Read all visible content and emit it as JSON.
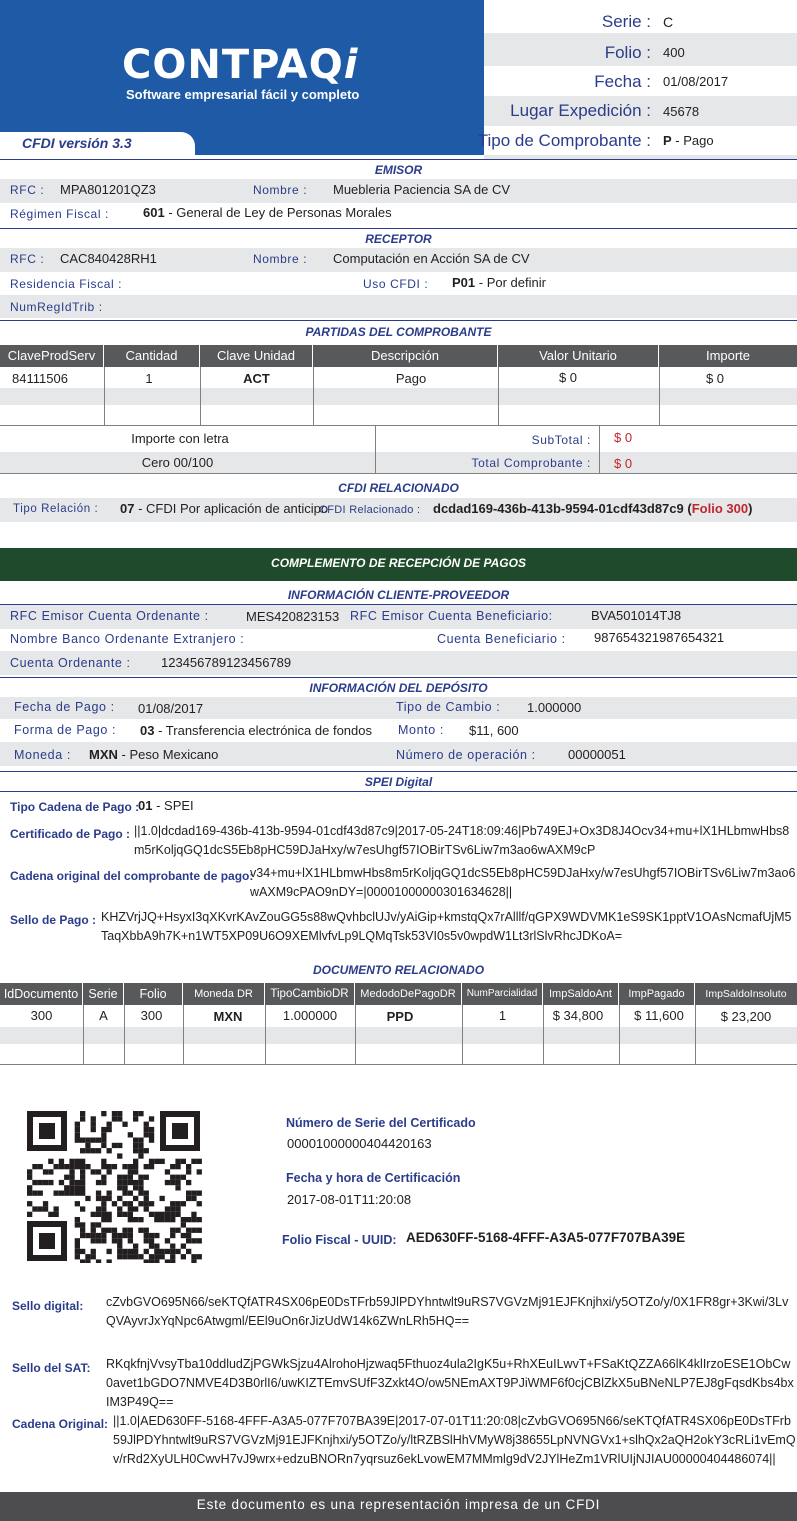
{
  "header": {
    "brand": "CONTPAQ",
    "brand_i": "i",
    "tagline": "Software empresarial fácil y completo",
    "cfdi_version": "CFDI versión 3.3",
    "serie_label": "Serie :",
    "serie_value": "C",
    "folio_label": "Folio :",
    "folio_value": "400",
    "fecha_label": "Fecha :",
    "fecha_value": "01/08/2017",
    "lugar_label": "Lugar Expedición :",
    "lugar_value": "45678",
    "tipo_label": "Tipo de Comprobante :",
    "tipo_code": "P",
    "tipo_value": "- Pago",
    "colors": {
      "blue": "#1f5aa6",
      "navy": "#2b3c8a",
      "green": "#1f4a2b",
      "red": "#c0262f"
    }
  },
  "emisor": {
    "title": "EMISOR",
    "rfc_label": "RFC :",
    "rfc_value": "MPA801201QZ3",
    "nombre_label": "Nombre :",
    "nombre_value": "Muebleria Paciencia SA de CV",
    "regimen_label": "Régimen Fiscal :",
    "regimen_code": "601",
    "regimen_value": "- General de Ley de Personas Morales"
  },
  "receptor": {
    "title": "RECEPTOR",
    "rfc_label": "RFC :",
    "rfc_value": "CAC840428RH1",
    "nombre_label": "Nombre :",
    "nombre_value": "Computación en Acción SA de CV",
    "residencia_label": "Residencia Fiscal :",
    "uso_label": "Uso CFDI :",
    "uso_code": "P01",
    "uso_value": "- Por definir",
    "numreg_label": "NumRegIdTrib :"
  },
  "partidas": {
    "title": "PARTIDAS DEL COMPROBANTE",
    "headers": [
      "ClaveProdServ",
      "Cantidad",
      "Clave Unidad",
      "Descripción",
      "Valor Unitario",
      "Importe"
    ],
    "row": [
      "84111506",
      "1",
      "ACT",
      "Pago",
      "$ 0",
      "$ 0"
    ],
    "importe_letra_label": "Importe con letra",
    "importe_letra_value": "Cero 00/100",
    "subtotal_label": "SubTotal :",
    "subtotal_value": "$ 0",
    "total_label": "Total Comprobante :",
    "total_value": "$ 0"
  },
  "relacionado": {
    "title": "CFDI RELACIONADO",
    "tipo_label": "Tipo Relación :",
    "tipo_code": "07",
    "tipo_value": "- CFDI Por aplicación de anticipo",
    "cfdi_label": "CFDI Relacionado :",
    "cfdi_value": "dcdad169-436b-413b-9594-01cdf43d87c9",
    "folio_open": "(",
    "folio_ref": "Folio 300",
    "folio_close": ")"
  },
  "complemento": {
    "title": "COMPLEMENTO DE RECEPCIÓN DE PAGOS"
  },
  "cliente_proveedor": {
    "title": "INFORMACIÓN CLIENTE-PROVEEDOR",
    "rfc_ord_label": "RFC Emisor Cuenta Ordenante :",
    "rfc_ord_value": "MES420823153",
    "rfc_ben_label": "RFC Emisor Cuenta Beneficiario:",
    "rfc_ben_value": "BVA501014TJ8",
    "banco_label": "Nombre Banco Ordenante Extranjero :",
    "cuenta_ben_label": "Cuenta Beneficiario :",
    "cuenta_ben_value": "987654321987654321",
    "cuenta_ord_label": "Cuenta Ordenante :",
    "cuenta_ord_value": "123456789123456789"
  },
  "deposito": {
    "title": "INFORMACIÓN DEL DEPÓSITO",
    "fecha_label": "Fecha de Pago :",
    "fecha_value": "01/08/2017",
    "tipo_cambio_label": "Tipo de Cambio :",
    "tipo_cambio_value": "1.000000",
    "forma_label": "Forma de Pago :",
    "forma_code": "03",
    "forma_value": "- Transferencia electrónica de fondos",
    "monto_label": "Monto :",
    "monto_value": "$11, 600",
    "moneda_label": "Moneda :",
    "moneda_code": "MXN",
    "moneda_value": "-  Peso Mexicano",
    "operacion_label": "Número de operación :",
    "operacion_value": "00000051"
  },
  "spei": {
    "title": "SPEI Digital",
    "tipo_cadena_label": "Tipo Cadena de Pago :",
    "tipo_cadena_code": "01",
    "tipo_cadena_value": "- SPEI",
    "certificado_label": "Certificado de Pago :",
    "certificado_value": "||1.0|dcdad169-436b-413b-9594-01cdf43d87c9|2017-05-24T18:09:46|Pb749EJ+Ox3D8J4Ocv34+mu+lX1HLbmwHbs8m5rKoljqGQ1dcS5Eb8pHC59DJaHxy/w7esUhgf57IOBirTSv6Liw7m3ao6wAXM9cP",
    "cadena_label": "Cadena original del comprobante de pago:",
    "cadena_value": "v34+mu+lX1HLbmwHbs8m5rKoljqGQ1dcS5Eb8pHC59DJaHxy/w7esUhgf57IOBirTSv6Liw7m3ao6wAXM9cPAO9nDY=|00001000000301634628||",
    "sello_label": "Sello de Pago :",
    "sello_value": "KHZVrjJQ+HsyxI3qXKvrKAvZouGG5s88wQvhbclUJv/yAiGip+kmstqQx7rAlllf/qGPX9WDVMK1eS9SK1pptV1OAsNcmafUjM5TaqXbbA9h7K+n1WT5XP09U6O9XEMlvfvLp9LQMqTsk53VI0s5v0wpdW1Lt3rlSlvRhcJDKoA="
  },
  "doc_relacionado": {
    "title": "DOCUMENTO RELACIONADO",
    "headers": [
      "IdDocumento",
      "Serie",
      "Folio",
      "Moneda DR",
      "TipoCambioDR",
      "MedodoDePagoDR",
      "NumParcialidad",
      "ImpSaldoAnt",
      "ImpPagado",
      "ImpSaldoInsoluto"
    ],
    "row": [
      "300",
      "A",
      "300",
      "MXN",
      "1.000000",
      "PPD",
      "1",
      "$ 34,800",
      "$ 11,600",
      "$ 23,200"
    ]
  },
  "timbre": {
    "serie_cert_label": "Número de Serie del Certificado",
    "serie_cert_value": "00001000000404420163",
    "fecha_cert_label": "Fecha y hora de Certificación",
    "fecha_cert_value": "2017-08-01T11:20:08",
    "uuid_label": "Folio  Fiscal  - UUID:",
    "uuid_value": "AED630FF-5168-4FFF-A3A5-077F707BA39E",
    "sello_digital_label": "Sello digital:",
    "sello_digital_value": "cZvbGVO695N66/seKTQfATR4SX06pE0DsTFrb59JlPDYhntwlt9uRS7VGVzMj91EJFKnjhxi/y5OTZo/y/0X1FR8gr+3Kwi/3LvQVAyvrJxYqNpc6Atwgml/EEl9uOn6rJizUdW14k6ZWnLRh5HQ==",
    "sello_sat_label": "Sello del SAT:",
    "sello_sat_value": "RKqkfnjVvsyTba10ddludZjPGWkSjzu4AlrohoHjzwaq5Fthuoz4ula2IgK5u+RhXEuILwvT+FSaKtQZZA66lK4klIrzoESE1ObCw0avet1bGDO7NMVE4D3B0rlI6/uwKIZTEmvSUfF3Zxkt4O/ow5NEmAXT9PJiWMF6f0cjCBlZkX5uBNeNLP7EJ8gFqsdKbs4bxIM3P49Q==",
    "cadena_label": "Cadena Original:",
    "cadena_value": "||1.0|AED630FF-5168-4FFF-A3A5-077F707BA39E|2017-07-01T11:20:08|cZvbGVO695N66/seKTQfATR4SX06pE0DsTFrb59JlPDYhntwlt9uRS7VGVzMj91EJFKnjhxi/y5OTZo/y/ltRZBSlHhVMyW8j38655LpNVNGVx1+slhQx2aQH2okY3cRLi1vEmQv/rRd2XyULH0CwvH7vJ9wrx+edzuBNORn7yqrsuz6ekLvowEM7MMmlg9dV2JYlHeZm1VRlUIjNJIAU00000404486074||"
  },
  "footer": {
    "text": "Este documento es una representación impresa de un CFDI"
  }
}
